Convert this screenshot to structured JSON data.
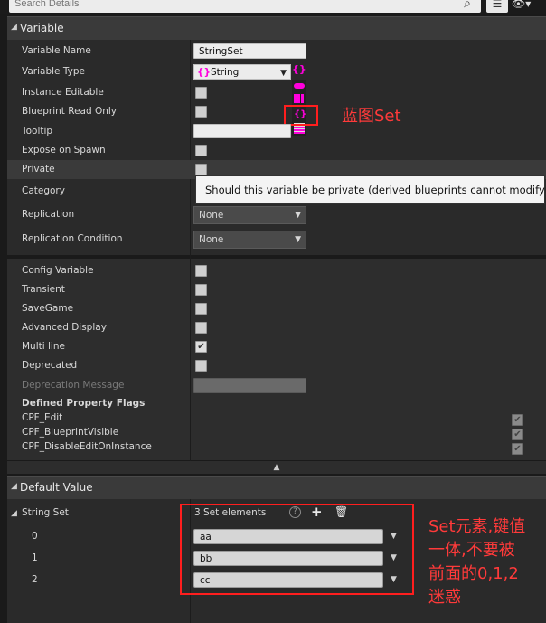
{
  "search": {
    "placeholder": "Search Details"
  },
  "sections": {
    "variable": "Variable",
    "default_value": "Default Value"
  },
  "rows": {
    "variable_name": {
      "label": "Variable Name",
      "value": "StringSet"
    },
    "variable_type": {
      "label": "Variable Type",
      "value": "String"
    },
    "instance_editable": {
      "label": "Instance Editable",
      "checked": false
    },
    "blueprint_read_only": {
      "label": "Blueprint Read Only",
      "checked": false
    },
    "tooltip": {
      "label": "Tooltip",
      "value": ""
    },
    "expose_on_spawn": {
      "label": "Expose on Spawn",
      "checked": false
    },
    "private": {
      "label": "Private",
      "checked": false
    },
    "category": {
      "label": "Category"
    },
    "replication": {
      "label": "Replication",
      "value": "None"
    },
    "replication_condition": {
      "label": "Replication Condition",
      "value": "None"
    },
    "config_variable": {
      "label": "Config Variable",
      "checked": false
    },
    "transient": {
      "label": "Transient",
      "checked": false
    },
    "savegame": {
      "label": "SaveGame",
      "checked": false
    },
    "advanced_display": {
      "label": "Advanced Display",
      "checked": false
    },
    "multi_line": {
      "label": "Multi line",
      "checked": true
    },
    "deprecated": {
      "label": "Deprecated",
      "checked": false
    },
    "deprecation_message": {
      "label": "Deprecation Message",
      "value": ""
    },
    "defined_property_flags": {
      "label": "Defined Property Flags"
    },
    "cpf_edit": {
      "label": "CPF_Edit",
      "checked": true
    },
    "cpf_blueprint_visible": {
      "label": "CPF_BlueprintVisible",
      "checked": true
    },
    "cpf_disable_edit_on_instance": {
      "label": "CPF_DisableEditOnInstance",
      "checked": true
    }
  },
  "tooltip_text": "Should this variable be private (derived blueprints cannot modify it)?",
  "default_value": {
    "property_label": "String Set",
    "summary": "3 Set elements",
    "elements": [
      {
        "index": "0",
        "value": "aa"
      },
      {
        "index": "1",
        "value": "bb"
      },
      {
        "index": "2",
        "value": "cc"
      }
    ]
  },
  "annotations": {
    "blueprint_set": "蓝图Set",
    "set_note_line1": "Set元素,键值",
    "set_note_line2": "一体,不要被",
    "set_note_line3": "前面的0,1,2",
    "set_note_line4": "迷惑"
  },
  "colors": {
    "pin_magenta": "#ff00dd",
    "annotation_red": "#ff1e1e"
  },
  "icons": {
    "search": "search-icon",
    "list_view": "list-view-icon",
    "eye": "eye-icon",
    "help": "help-icon",
    "add": "plus-icon",
    "delete": "trash-icon",
    "dropdown": "chevron-down-icon",
    "collapse": "collapse-triangle-icon"
  }
}
